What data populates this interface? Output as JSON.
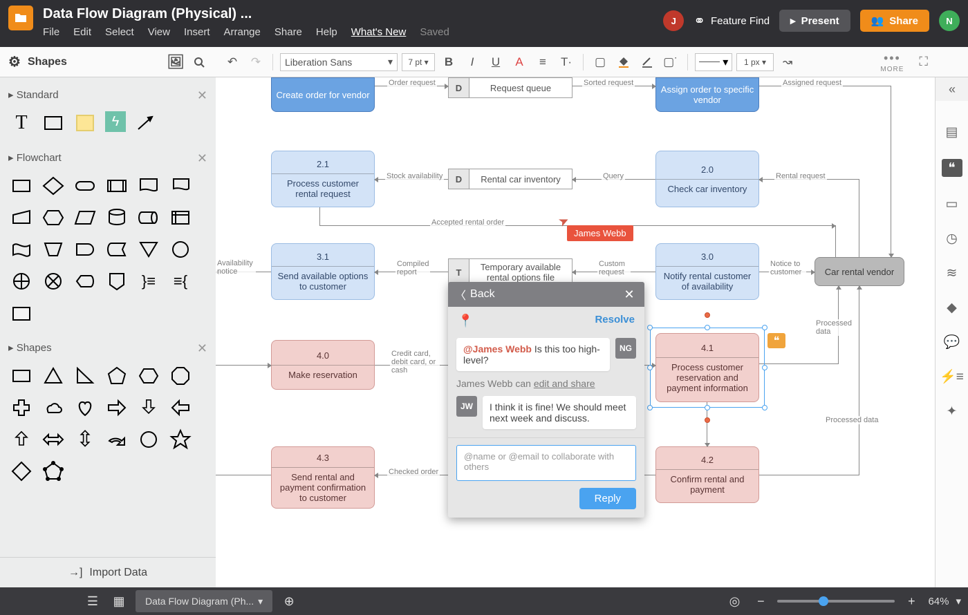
{
  "title": "Data Flow Diagram (Physical) ...",
  "menus": [
    "File",
    "Edit",
    "Select",
    "View",
    "Insert",
    "Arrange",
    "Share",
    "Help"
  ],
  "whatsnew": "What's New",
  "saved": "Saved",
  "feature_find": "Feature Find",
  "btn_present": "Present",
  "btn_share": "Share",
  "avatar1": "J",
  "avatar2": "N",
  "toolbar": {
    "font": "Liberation Sans",
    "size": "7 pt",
    "line_width": "1 px",
    "more": "MORE"
  },
  "left": {
    "shapes_header": "Shapes",
    "import": "Import Data",
    "groups": [
      {
        "name": "Standard"
      },
      {
        "name": "Flowchart"
      },
      {
        "name": "Shapes"
      }
    ]
  },
  "cursor_user": "James Webb",
  "nodes": {
    "n10": {
      "num": "",
      "text": "Create order for vendor"
    },
    "d1": {
      "tag": "D",
      "text": "Request queue"
    },
    "n11": {
      "num": "",
      "text": "Assign order to specific vendor"
    },
    "n21": {
      "num": "2.1",
      "text": "Process customer rental request"
    },
    "d2": {
      "tag": "D",
      "text": "Rental car inventory"
    },
    "n20": {
      "num": "2.0",
      "text": "Check car inventory"
    },
    "n31": {
      "num": "3.1",
      "text": "Send available options to customer"
    },
    "d3": {
      "tag": "T",
      "text": "Temporary available rental options file"
    },
    "n30": {
      "num": "3.0",
      "text": "Notify rental customer of availability"
    },
    "vendor": {
      "text": "Car rental vendor"
    },
    "n40": {
      "num": "4.0",
      "text": "Make reservation"
    },
    "n41": {
      "num": "4.1",
      "text": "Process customer reservation and payment information"
    },
    "n43": {
      "num": "4.3",
      "text": "Send rental and payment confirmation to customer"
    },
    "n42": {
      "num": "4.2",
      "text": "Confirm rental and payment"
    }
  },
  "edges": {
    "e1": "Order request",
    "e2": "Sorted request",
    "e3": "Assigned request",
    "e4": "Stock availability",
    "e5": "Query",
    "e6": "Rental request",
    "e7": "Accepted rental order",
    "e8": "Availability notice",
    "e9": "Compiled report",
    "e10": "Custom request",
    "e11": "Notice to customer",
    "e12": "Processed data",
    "e13": "Credit card, debit card, or cash",
    "e14": "Checked order",
    "e15": "Processed data"
  },
  "comment": {
    "back": "Back",
    "resolve": "Resolve",
    "c1_initials": "NG",
    "c1_mention": "@James Webb",
    "c1_text": "Is this too high-level?",
    "share_hint_name": "James Webb",
    "share_hint_rest": " can ",
    "share_hint_link": "edit and share",
    "c2_initials": "JW",
    "c2_text": "I think it is fine! We should meet next week and discuss.",
    "placeholder": "@name or @email to collaborate with others",
    "reply": "Reply"
  },
  "bottom": {
    "page": "Data Flow Diagram (Ph...",
    "zoom": "64%"
  }
}
